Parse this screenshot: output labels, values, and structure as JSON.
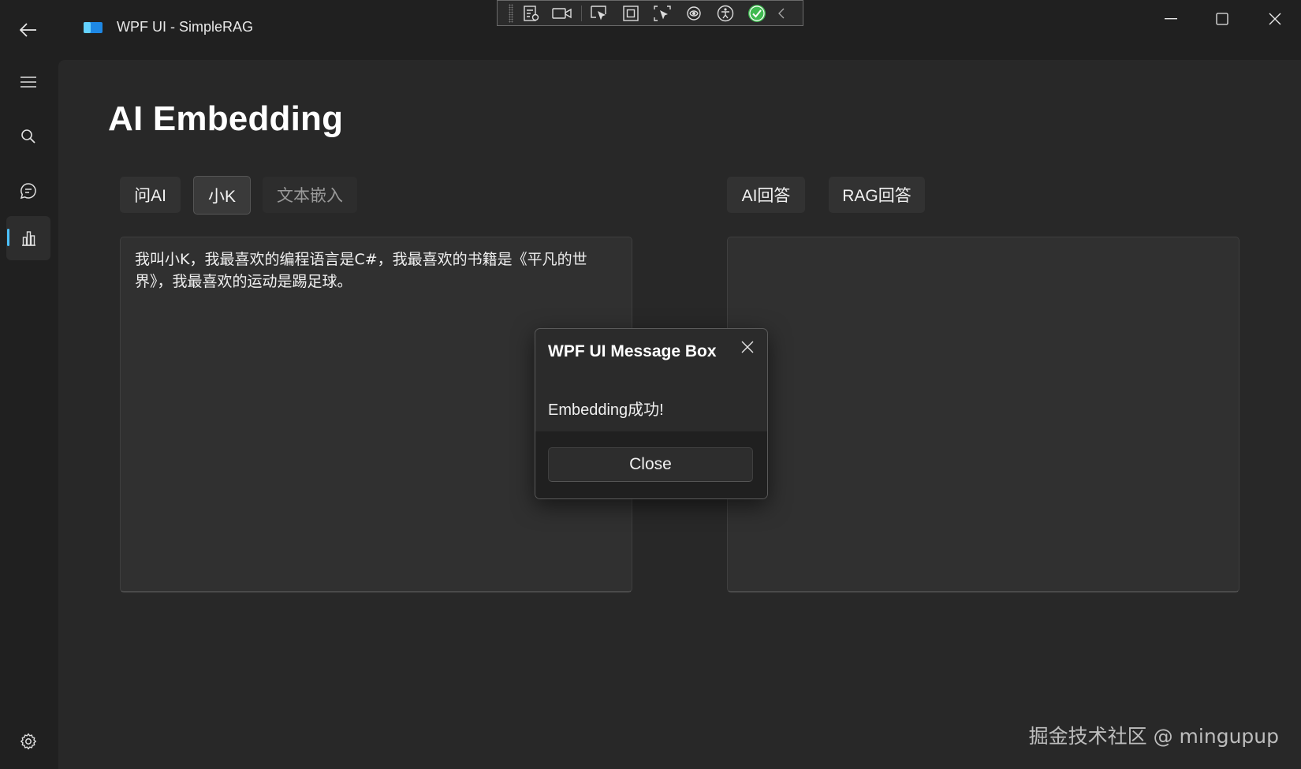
{
  "window": {
    "title": "WPF UI - SimpleRAG"
  },
  "page": {
    "title": "AI Embedding"
  },
  "left_buttons": [
    {
      "label": "问AI"
    },
    {
      "label": "小K"
    },
    {
      "label": "文本嵌入"
    }
  ],
  "right_buttons": [
    {
      "label": "AI回答"
    },
    {
      "label": "RAG回答"
    }
  ],
  "input_box": {
    "text": "我叫小K，我最喜欢的编程语言是C#，我最喜欢的书籍是《平凡的世界》，我最喜欢的运动是踢足球。"
  },
  "output_box": {
    "text": ""
  },
  "dialog": {
    "title": "WPF UI Message Box",
    "message": "Embedding成功!",
    "close_label": "Close"
  },
  "nav": {
    "items": [
      {
        "icon": "hamburger-menu-icon"
      },
      {
        "icon": "search-icon"
      },
      {
        "icon": "chat-icon"
      },
      {
        "icon": "bar-chart-icon",
        "active": true
      },
      {
        "icon": "settings-gear-icon"
      }
    ]
  },
  "watermark": "掘金技术社区 @ mingupup",
  "colors": {
    "accent": "#4cc2ff",
    "background": "#202020",
    "content": "#282828"
  }
}
